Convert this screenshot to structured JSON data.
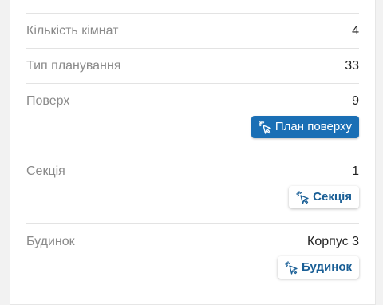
{
  "rows": [
    {
      "label": "Кількість кімнат",
      "value": "4"
    },
    {
      "label": "Тип планування",
      "value": "33"
    },
    {
      "label": "Поверх",
      "value": "9",
      "button": "План поверху"
    },
    {
      "label": "Секція",
      "value": "1",
      "button": "Секція"
    },
    {
      "label": "Будинок",
      "value": "Корпус 3",
      "button": "Будинок"
    }
  ],
  "icons": {
    "button_icon": "cursor-click-icon"
  },
  "colors": {
    "primary": "#1a6fb5",
    "outline_text": "#1a5f96",
    "label": "#8a8a8a"
  }
}
